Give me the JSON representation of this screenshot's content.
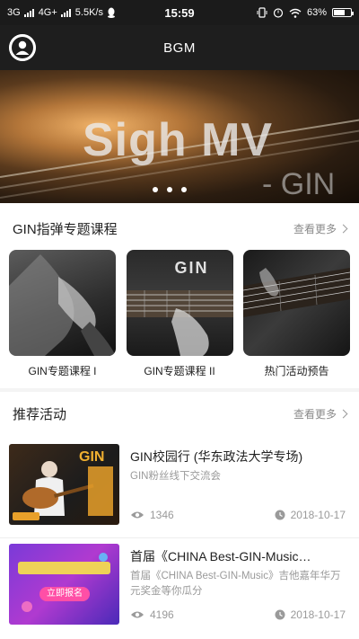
{
  "statusbar": {
    "net1": "3G",
    "net2": "4G+",
    "speed": "5.5K/s",
    "time": "15:59",
    "battery": "63%"
  },
  "appbar": {
    "title": "BGM",
    "avatar_icon": "user-avatar-icon"
  },
  "banner": {
    "title": "Sigh MV",
    "subtitle": "- GIN",
    "pages": 3
  },
  "courses_section": {
    "title": "GIN指弹专题课程",
    "more": "查看更多",
    "items": [
      {
        "label": "GIN专题课程 I"
      },
      {
        "label": "GIN专题课程 II",
        "logo": "GIN"
      },
      {
        "label": "热门活动预告"
      }
    ]
  },
  "activities_section": {
    "title": "推荐活动",
    "more": "查看更多",
    "items": [
      {
        "title": "GIN校园行 (华东政法大学专场)",
        "desc": "GIN粉丝线下交流会",
        "views": "1346",
        "date": "2018-10-17",
        "thumb_logo": "GIN"
      },
      {
        "title": "首届《CHINA Best-GIN-Music…",
        "desc": "首届《CHINA Best-GIN-Music》吉他嘉年华万元奖金等你瓜分",
        "views": "4196",
        "date": "2018-10-17",
        "thumb_button": "立即报名"
      }
    ]
  },
  "colors": {
    "topbar": "#1e1e1e",
    "accent_text": "#222222",
    "muted_text": "#9a9a9a"
  }
}
